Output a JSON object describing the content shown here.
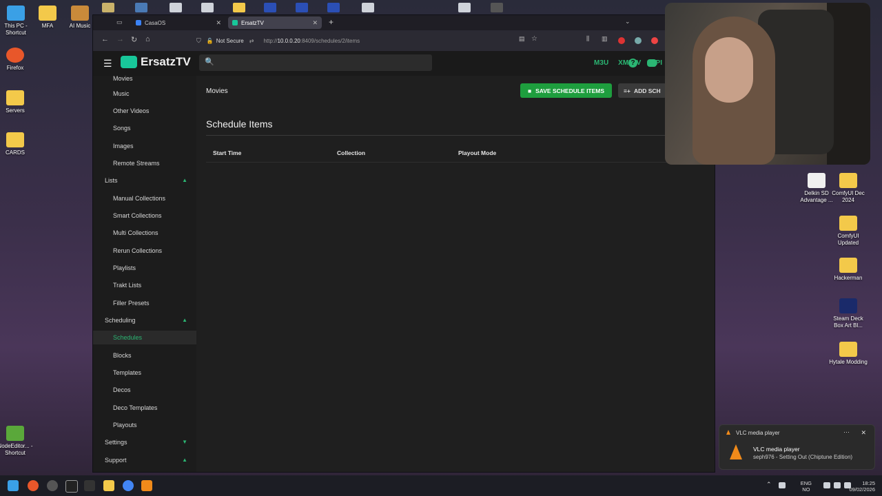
{
  "desktop": {
    "left_icons": [
      {
        "label": "This PC - Shortcut",
        "icon": "monitor-icon"
      },
      {
        "label": "MFA",
        "icon": "folder-icon"
      },
      {
        "label": "AI Music",
        "icon": "folder-icon"
      },
      {
        "label": "Firefox",
        "icon": "firefox-icon"
      },
      {
        "label": "Servers",
        "icon": "folder-icon"
      },
      {
        "label": "CARDS",
        "icon": "folder-icon"
      },
      {
        "label": "NodeEditor... - Shortcut",
        "icon": "app-icon"
      }
    ],
    "right_icons": [
      {
        "label": "Delkin SD Advantage ...",
        "icon": "app-icon"
      },
      {
        "label": "ComfyUI Dec 2024",
        "icon": "folder-icon"
      },
      {
        "label": "ComfyUI Updated",
        "icon": "folder-icon"
      },
      {
        "label": "Hackerman",
        "icon": "folder-icon"
      },
      {
        "label": "Steam Deck Box Art Bl...",
        "icon": "photoshop-icon"
      },
      {
        "label": "Hytale Modding",
        "icon": "folder-icon"
      }
    ]
  },
  "browser": {
    "tabs": [
      {
        "label": "CasaOS"
      },
      {
        "label": "ErsatzTV"
      }
    ],
    "new_tab": "+",
    "url_security": "Not Secure",
    "url_host": "10.0.0.20",
    "url_prefix": "http://",
    "url_rest": ":8409/schedules/2/items"
  },
  "app": {
    "name": "ErsatzTV",
    "header_links": [
      "M3U",
      "XMLTV",
      "API"
    ],
    "sidebar": {
      "items": [
        {
          "label": "Movies",
          "type": "item"
        },
        {
          "label": "Music",
          "type": "item"
        },
        {
          "label": "Other Videos",
          "type": "item"
        },
        {
          "label": "Songs",
          "type": "item"
        },
        {
          "label": "Images",
          "type": "item"
        },
        {
          "label": "Remote Streams",
          "type": "item"
        },
        {
          "label": "Lists",
          "type": "group"
        },
        {
          "label": "Manual Collections",
          "type": "item"
        },
        {
          "label": "Smart Collections",
          "type": "item"
        },
        {
          "label": "Multi Collections",
          "type": "item"
        },
        {
          "label": "Rerun Collections",
          "type": "item"
        },
        {
          "label": "Playlists",
          "type": "item"
        },
        {
          "label": "Trakt Lists",
          "type": "item"
        },
        {
          "label": "Filler Presets",
          "type": "item"
        },
        {
          "label": "Scheduling",
          "type": "group"
        },
        {
          "label": "Schedules",
          "type": "item",
          "active": true
        },
        {
          "label": "Blocks",
          "type": "item"
        },
        {
          "label": "Templates",
          "type": "item"
        },
        {
          "label": "Decos",
          "type": "item"
        },
        {
          "label": "Deco Templates",
          "type": "item"
        },
        {
          "label": "Playouts",
          "type": "item"
        },
        {
          "label": "Settings",
          "type": "group"
        },
        {
          "label": "Support",
          "type": "group"
        }
      ]
    },
    "main": {
      "breadcrumb": "Movies",
      "save_button": "SAVE SCHEDULE ITEMS",
      "add_button": "ADD SCH",
      "section_title": "Schedule Items",
      "columns": [
        "Start Time",
        "Collection",
        "Playout Mode"
      ]
    }
  },
  "notification": {
    "app": "VLC media player",
    "title": "VLC media player",
    "body": "seph976 - Setting Out (Chiptune Edition)"
  },
  "taskbar": {
    "lang_top": "ENG",
    "lang_bottom": "NO",
    "time": "18:25",
    "date": "09/02/2026"
  },
  "colors": {
    "accent": "#2bb673",
    "save_button": "#1e9e3e",
    "vlc_orange": "#f08a1a"
  }
}
